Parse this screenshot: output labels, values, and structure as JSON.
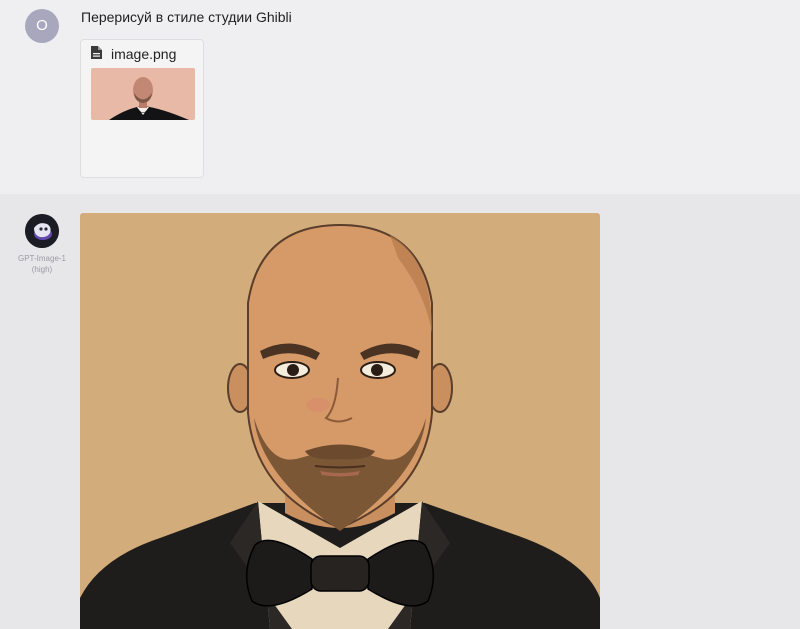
{
  "user_message": {
    "avatar_letter": "O",
    "text": "Перерисуй в стиле студии Ghibli",
    "attachment": {
      "file_name": "image.png",
      "icon": "file-icon"
    }
  },
  "bot_message": {
    "bot_name": "GPT-Image-1",
    "bot_mode": "(high)",
    "avatar_icon": "bot-avatar-icon"
  },
  "colors": {
    "user_bg": "#efeff1",
    "bot_bg": "#e7e7ea",
    "user_avatar": "#a8a7bd",
    "image_bg": "#d2ac7a"
  }
}
